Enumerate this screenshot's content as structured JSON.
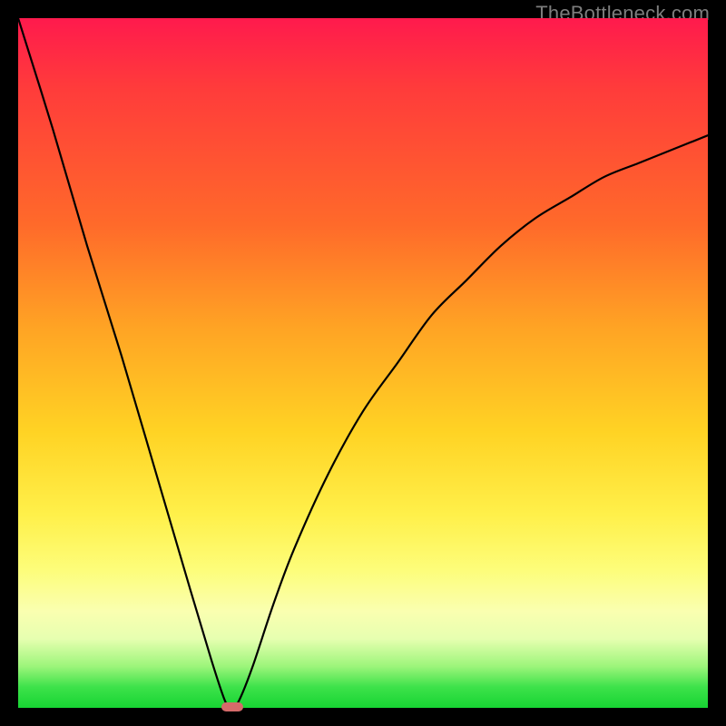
{
  "watermark": "TheBottleneck.com",
  "chart_data": {
    "type": "line",
    "title": "",
    "xlabel": "",
    "ylabel": "",
    "xlim": [
      0,
      100
    ],
    "ylim": [
      0,
      100
    ],
    "grid": false,
    "legend": false,
    "series": [
      {
        "name": "bottleneck-curve",
        "x": [
          0,
          5,
          10,
          15,
          20,
          25,
          28,
          30,
          31,
          32,
          34,
          37,
          40,
          45,
          50,
          55,
          60,
          65,
          70,
          75,
          80,
          85,
          90,
          95,
          100
        ],
        "values": [
          100,
          84,
          67,
          51,
          34,
          17,
          7,
          1,
          0,
          1,
          6,
          15,
          23,
          34,
          43,
          50,
          57,
          62,
          67,
          71,
          74,
          77,
          79,
          81,
          83
        ]
      }
    ],
    "annotations": [
      {
        "name": "minimum-marker",
        "x": 31,
        "y": 0
      }
    ],
    "background_gradient": {
      "top": "#ff1a4d",
      "middle": "#ffd324",
      "bottom": "#17d433"
    }
  }
}
